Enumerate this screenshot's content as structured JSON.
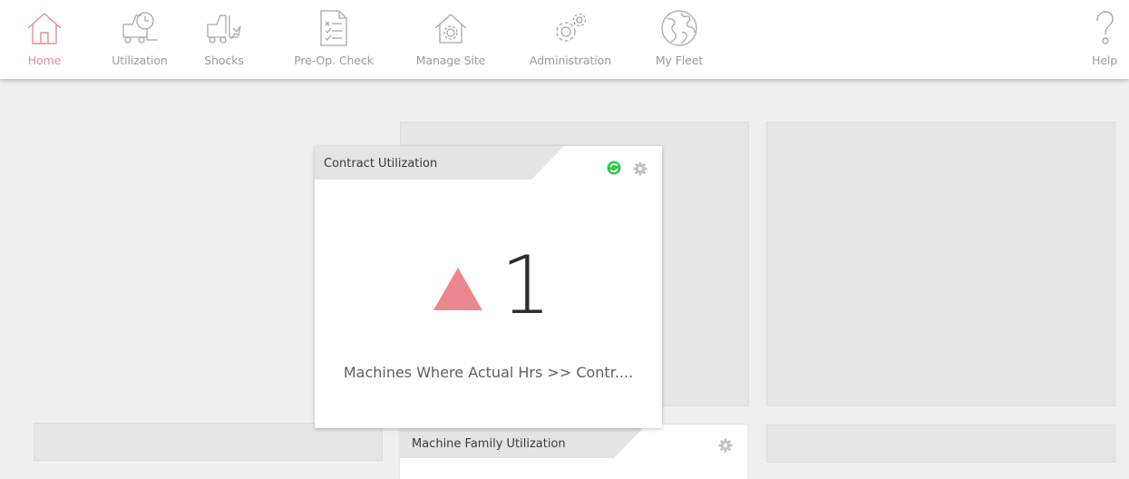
{
  "nav": {
    "items": [
      {
        "label": "Home",
        "icon": "home-icon"
      },
      {
        "label": "Utilization",
        "icon": "utilization-icon"
      },
      {
        "label": "Shocks",
        "icon": "shocks-icon"
      },
      {
        "label": "Pre-Op. Check",
        "icon": "checklist-icon"
      },
      {
        "label": "Manage Site",
        "icon": "manage-site-icon"
      },
      {
        "label": "Administration",
        "icon": "gears-icon"
      },
      {
        "label": "My Fleet",
        "icon": "globe-icon"
      }
    ],
    "help": {
      "label": "Help",
      "icon": "help-icon"
    },
    "active_color": "#e98b93"
  },
  "widgets": {
    "contract": {
      "title": "Contract Utilization",
      "value": "1",
      "trend": "up",
      "trend_color": "#ec8790",
      "caption": "Machines Where Actual Hrs >> Contr...."
    },
    "family": {
      "title": "Machine Family Utilization"
    }
  }
}
